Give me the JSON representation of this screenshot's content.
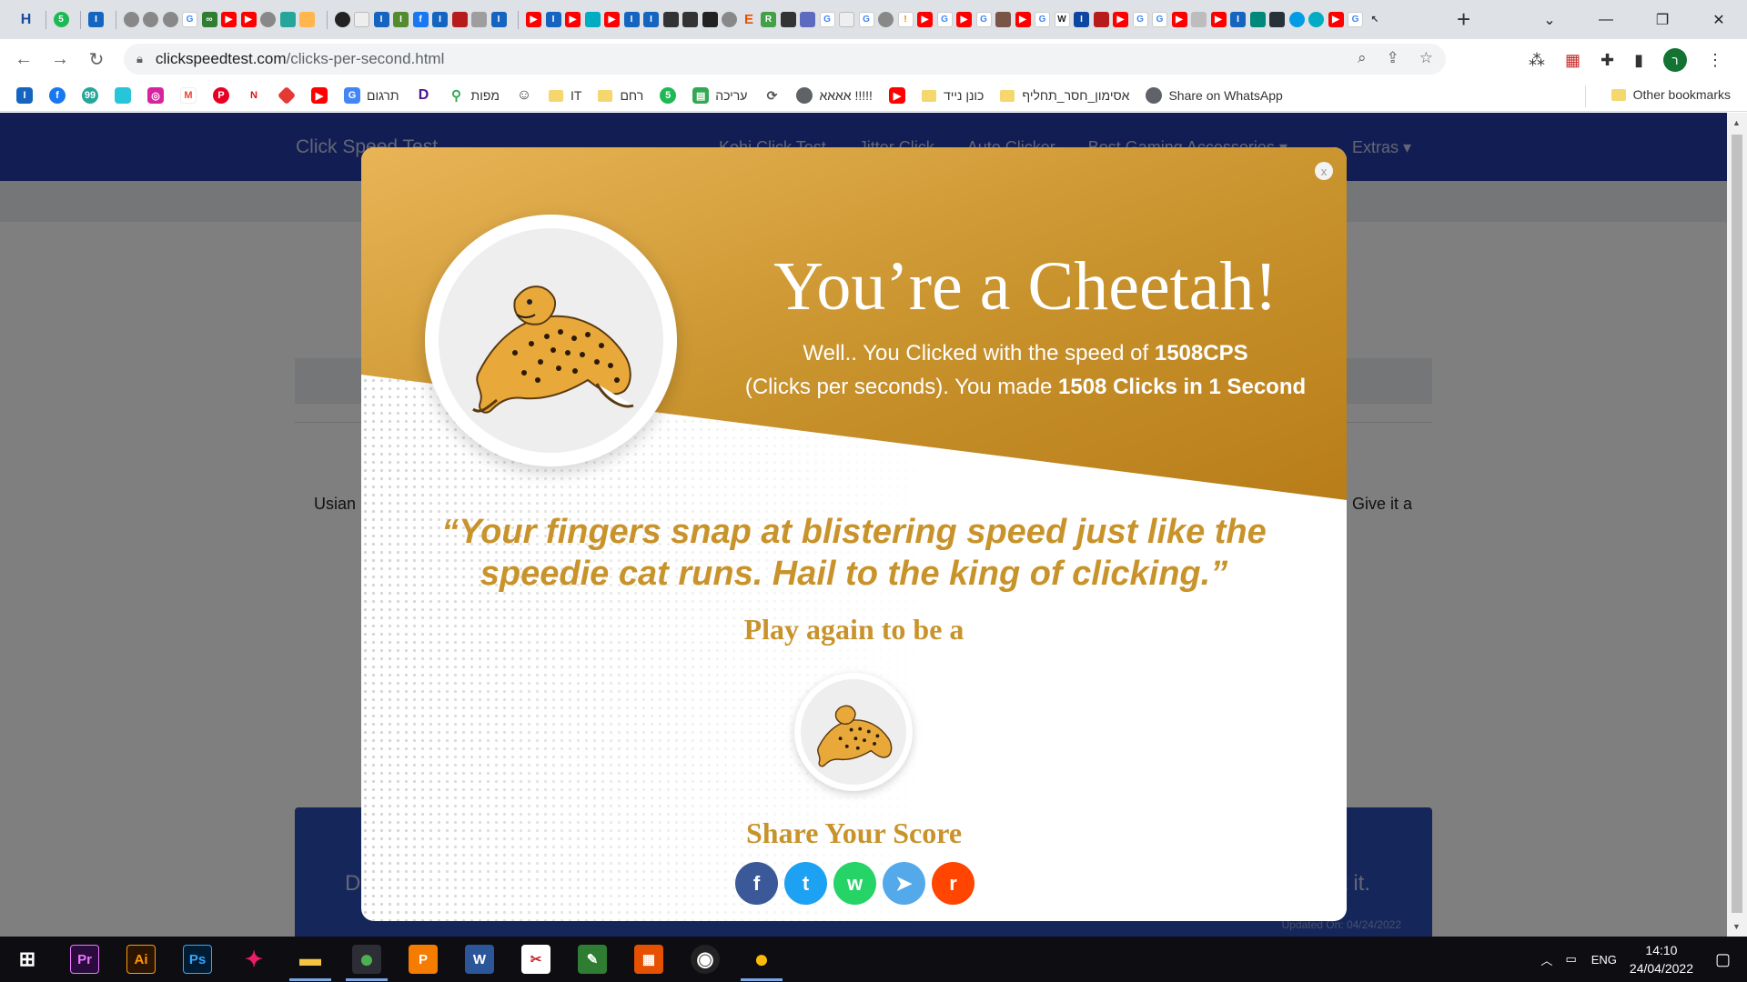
{
  "browser": {
    "active_tab_close": "✕",
    "new_tab": "+",
    "url_domain": "clickspeedtest.com",
    "url_path": "/clicks-per-second.html",
    "window_controls": [
      "⌄",
      "—",
      "❐",
      "✕"
    ]
  },
  "bookmarks": {
    "items": [
      {
        "label": "תרגום",
        "color": "#4285f4"
      },
      {
        "label": "מפות",
        "color": "#34a853"
      },
      {
        "label": "IT",
        "color": "#f5d76e"
      },
      {
        "label": "רחם",
        "color": "#f5d76e"
      },
      {
        "label": "עריכה",
        "color": "#34a853"
      },
      {
        "label": "אאאא !!!!!",
        "color": "#5f6368"
      },
      {
        "label": "כונן נייד",
        "color": "#f5d76e"
      },
      {
        "label": "אסימון_חסר_תחליף",
        "color": "#f5d76e"
      },
      {
        "label": "Share on WhatsApp",
        "color": "#5f6368"
      }
    ],
    "other": "Other bookmarks"
  },
  "site": {
    "brand": "Click Speed Test",
    "nav": [
      "Kohi Click Test",
      "Jitter Click",
      "Auto Clicker",
      "Best Gaming Accessories ▾"
    ],
    "extras": "Extras ▾",
    "bg_text_left": "Usian",
    "bg_text_right": "Give it a",
    "card_left": "D",
    "card_right": "t it.",
    "updated": "Updated On: 04/24/2022"
  },
  "modal": {
    "close": "x",
    "title": "You’re a Cheetah!",
    "sub_line1_pre": "Well.. You Clicked with the speed of ",
    "cps": "1508CPS",
    "sub_line2_pre": "(Clicks per seconds). You made ",
    "clicks": "1508 Clicks in 1 Second",
    "quote": "“Your fingers snap at blistering speed just like the speedie cat runs. Hail to the king of clicking.”",
    "play_again": "Play again to be a",
    "share_title": "Share Your Score",
    "share": [
      {
        "name": "facebook",
        "glyph": "f",
        "color": "#3b5998"
      },
      {
        "name": "twitter",
        "glyph": "t",
        "color": "#1da1f2"
      },
      {
        "name": "whatsapp",
        "glyph": "w",
        "color": "#25d366"
      },
      {
        "name": "telegram",
        "glyph": "➤",
        "color": "#54a9eb"
      },
      {
        "name": "reddit",
        "glyph": "r",
        "color": "#ff4500"
      }
    ]
  },
  "taskbar": {
    "apps": [
      {
        "name": "premiere",
        "label": "Pr",
        "color": "#2a0b3d",
        "fg": "#ea77ff"
      },
      {
        "name": "illustrator",
        "label": "Ai",
        "color": "#2b1400",
        "fg": "#ff9a00"
      },
      {
        "name": "photoshop",
        "label": "Ps",
        "color": "#001c33",
        "fg": "#31a8ff"
      },
      {
        "name": "kdenlive",
        "label": "✦",
        "color": "#0d0d12",
        "fg": "#e91e63"
      },
      {
        "name": "file-explorer",
        "label": "▬",
        "color": "#0d0d12",
        "fg": "#f5c542"
      },
      {
        "name": "chrome",
        "label": "●",
        "color": "#0d0d12",
        "fg": "#4caf50"
      },
      {
        "name": "pdf",
        "label": "P",
        "color": "#f57c00",
        "fg": "#fff"
      },
      {
        "name": "word",
        "label": "W",
        "color": "#2b579a",
        "fg": "#fff"
      },
      {
        "name": "snip",
        "label": "✂",
        "color": "#fff",
        "fg": "#c62828"
      },
      {
        "name": "notepad",
        "label": "✎",
        "color": "#2e7d32",
        "fg": "#fff"
      },
      {
        "name": "package",
        "label": "▦",
        "color": "#e65100",
        "fg": "#fff"
      },
      {
        "name": "obs",
        "label": "◉",
        "color": "#222",
        "fg": "#fff"
      },
      {
        "name": "chrome-2",
        "label": "●",
        "color": "#0d0d12",
        "fg": "#fbbc05"
      }
    ],
    "tray_lang": "ENG",
    "time": "14:10",
    "date": "24/04/2022"
  }
}
